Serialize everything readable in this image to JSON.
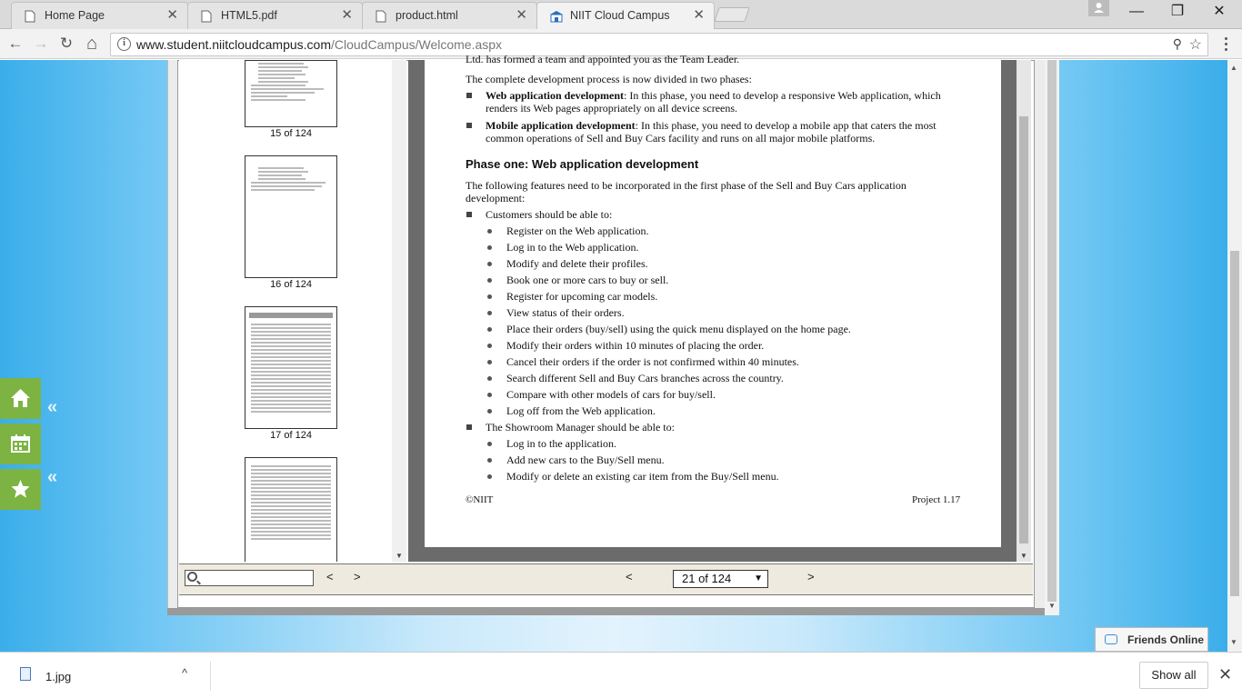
{
  "browser": {
    "tabs": [
      {
        "title": "Home Page",
        "close": "✕"
      },
      {
        "title": "HTML5.pdf",
        "close": "✕"
      },
      {
        "title": "product.html",
        "close": "✕"
      },
      {
        "title": "NIIT Cloud Campus",
        "close": "✕"
      }
    ],
    "window_controls": {
      "minimize": "—",
      "restore": "❐",
      "close": "✕"
    },
    "url_host": "www.student.niitcloudcampus.com",
    "url_path": "/CloudCampus/Welcome.aspx",
    "nav": {
      "back": "←",
      "forward": "→",
      "reload": "↻",
      "home": "⌂"
    }
  },
  "viewer": {
    "thumbnails": [
      {
        "label": "15 of 124"
      },
      {
        "label": "16 of 124"
      },
      {
        "label": "17 of 124"
      }
    ],
    "search_placeholder": "",
    "prev_match": "<",
    "next_match": ">",
    "prev_page": "<",
    "next_page": ">",
    "page_select": "21 of 124",
    "page_select_arrow": "▼"
  },
  "document": {
    "cut_line": "Ltd. has formed a team and appointed you as the Team Leader.",
    "intro": "The complete development process is now divided in two phases:",
    "phases": [
      {
        "bold": "Web application development",
        "text": ": In this phase, you need to develop a responsive Web application, which",
        "line2": "renders its Web pages appropriately on all device screens."
      },
      {
        "bold": "Mobile application development",
        "text": ": In this phase, you need to develop a mobile app that caters the most",
        "line2": "common operations of Sell and Buy Cars facility and runs on all major mobile platforms."
      }
    ],
    "heading": "Phase one: Web application development",
    "features_intro_1": "The following features need to be incorporated in the first phase of the Sell and Buy Cars application",
    "features_intro_2": "development:",
    "customers_label": "Customers should be able to:",
    "customer_items": [
      "Register on the Web application.",
      "Log in to the Web application.",
      "Modify and delete their profiles.",
      "Book one or more cars to buy or sell.",
      "Register for upcoming car models.",
      "View status of their orders.",
      "Place their orders (buy/sell) using the quick menu displayed on the home page.",
      "Modify their orders within 10 minutes of placing the order.",
      "Cancel their orders if the order is not confirmed within 40 minutes.",
      "Search different Sell and Buy Cars branches across the country.",
      "Compare with other models of cars for buy/sell.",
      "Log off from the Web application."
    ],
    "manager_label": "The Showroom Manager should be able to:",
    "manager_items": [
      "Log in to the application.",
      "Add new cars to the Buy/Sell menu.",
      "Modify or delete an existing car item from the Buy/Sell menu."
    ],
    "footer_left": "©NIIT",
    "footer_right": "Project 1.17"
  },
  "side_menu": {
    "chevron": "«"
  },
  "friends": {
    "label": "Friends Online"
  },
  "downloads": {
    "file": "1.jpg",
    "caret": "^",
    "show_all": "Show all",
    "close": "✕"
  }
}
